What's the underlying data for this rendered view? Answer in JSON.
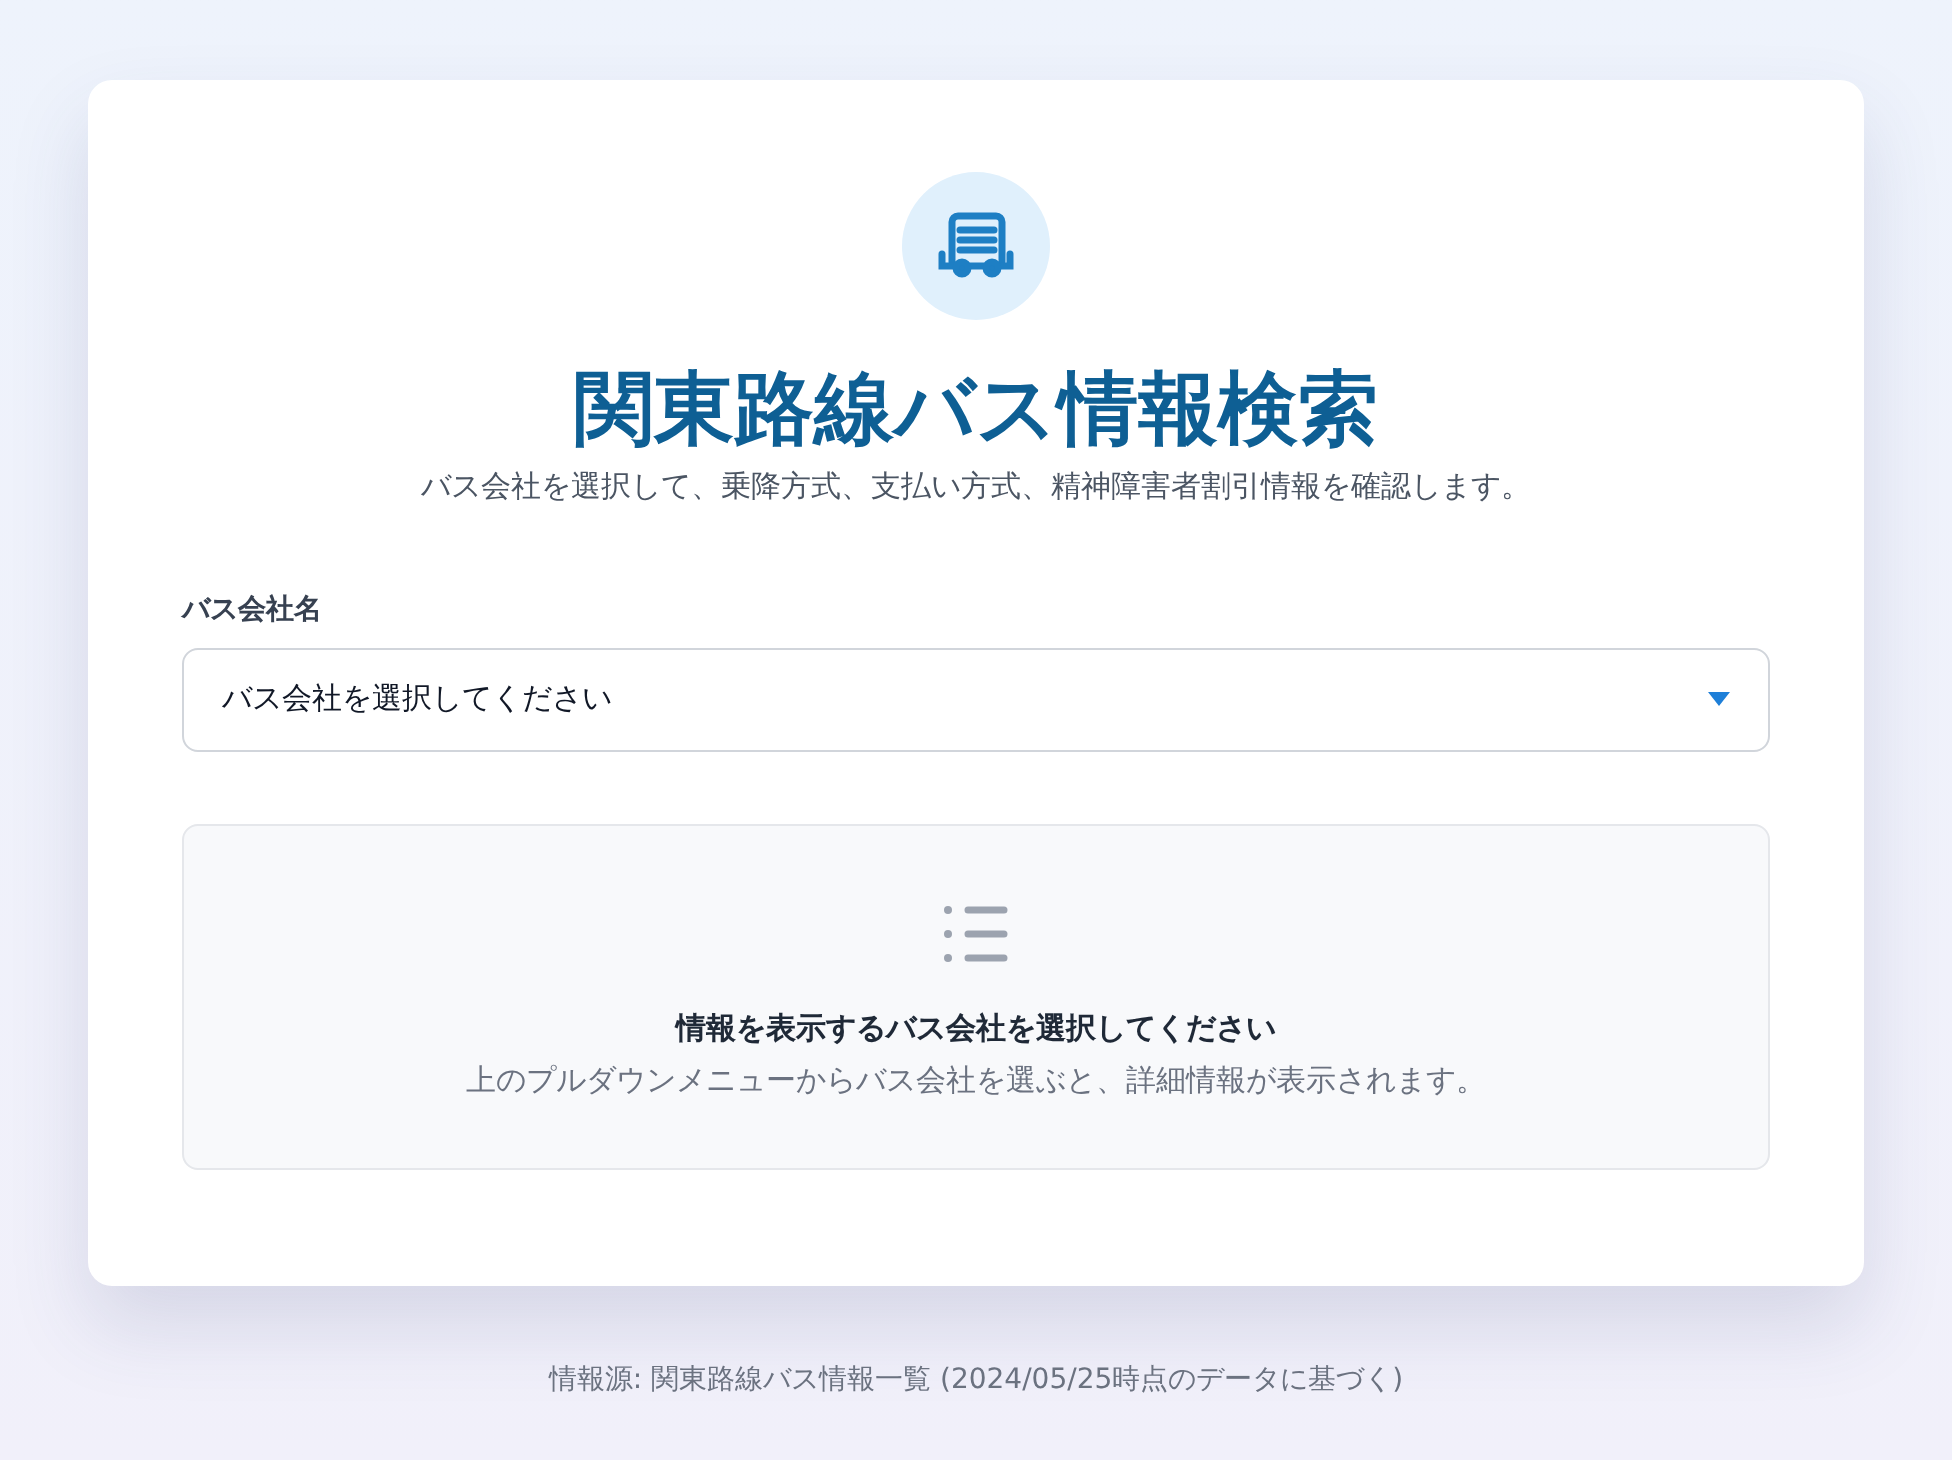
{
  "header": {
    "title": "関東路線バス情報検索",
    "subtitle": "バス会社を選択して、乗降方式、支払い方式、精神障害者割引情報を確認します。"
  },
  "company_select": {
    "label": "バス会社名",
    "value": "バス会社を選択してください"
  },
  "empty_state": {
    "title": "情報を表示するバス会社を選択してください",
    "message": "上のプルダウンメニューからバス会社を選ぶと、詳細情報が表示されます。"
  },
  "footer": "情報源: 関東路線バス情報一覧 (2024/05/25時点のデータに基づく)"
}
